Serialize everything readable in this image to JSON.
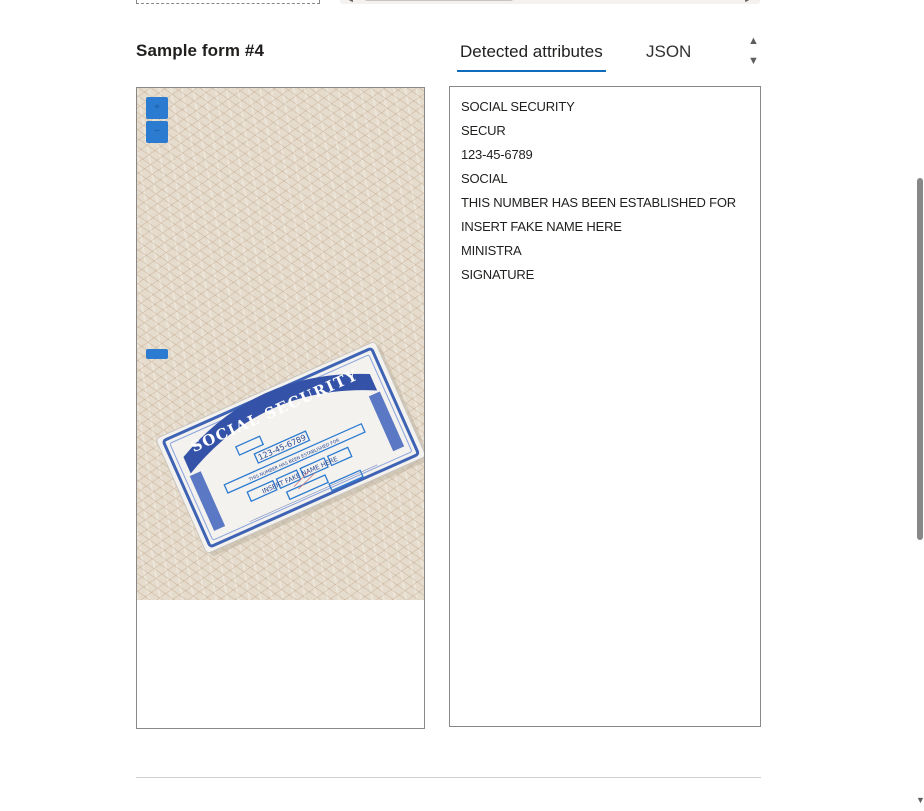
{
  "form": {
    "title": "Sample form #4"
  },
  "tabs": [
    {
      "label": "Detected attributes",
      "active": true
    },
    {
      "label": "JSON",
      "active": false
    }
  ],
  "attributes": [
    "SOCIAL SECURITY",
    "SECUR",
    "123-45-6789",
    "SOCIAL",
    "THIS NUMBER HAS BEEN ESTABLISHED FOR",
    "INSERT FAKE NAME HERE",
    "MINISTRA",
    "SIGNATURE"
  ],
  "image": {
    "icons": [
      "zoom-in-icon",
      "zoom-out-icon",
      "pan-bar"
    ]
  },
  "colors": {
    "accent": "#0f6cbd",
    "control_blue": "#2b7bd1",
    "border": "#8a8886"
  }
}
